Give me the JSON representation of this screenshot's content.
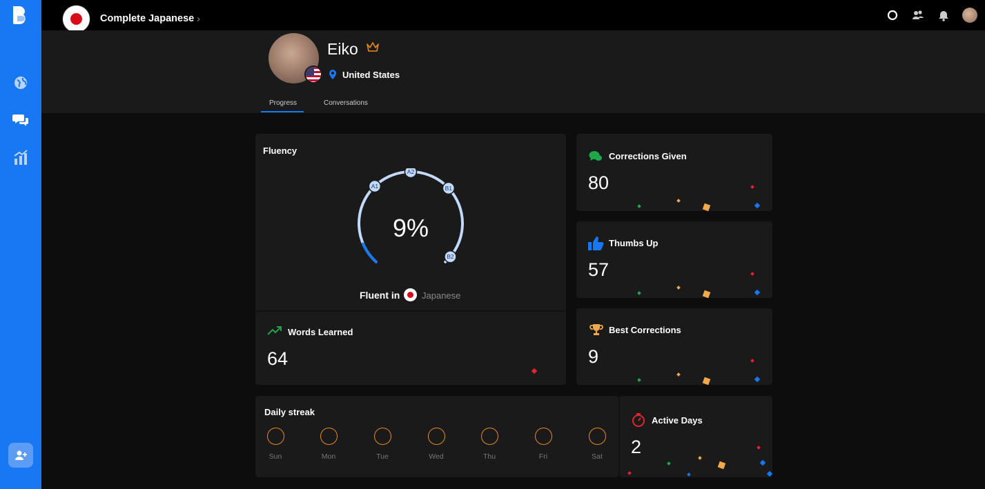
{
  "sidebar": {
    "nav": [
      {
        "icon": "globe-icon"
      },
      {
        "icon": "chat-icon"
      },
      {
        "icon": "stats-icon"
      }
    ],
    "add_friend_icon": "add-user-icon"
  },
  "topbar": {
    "course_title": "Complete Japanese",
    "chevron": "›",
    "icons": [
      "circle-icon",
      "users-icon",
      "bell-icon",
      "avatar"
    ]
  },
  "profile": {
    "name": "Eiko",
    "location": "United States",
    "tabs": [
      {
        "label": "Progress",
        "active": true
      },
      {
        "label": "Conversations",
        "active": false
      }
    ]
  },
  "fluency": {
    "title": "Fluency",
    "percent": "9%",
    "progress_fraction": 0.09,
    "levels": [
      "A1",
      "A2",
      "B1",
      "B2"
    ],
    "fluent_in_label": "Fluent in",
    "language": "Japanese"
  },
  "words_learned": {
    "title": "Words Learned",
    "value": "64"
  },
  "corrections_given": {
    "title": "Corrections Given",
    "value": "80"
  },
  "thumbs_up": {
    "title": "Thumbs Up",
    "value": "57"
  },
  "best_corrections": {
    "title": "Best Corrections",
    "value": "9"
  },
  "daily_streak": {
    "title": "Daily streak",
    "days": [
      "Sun",
      "Mon",
      "Tue",
      "Wed",
      "Thu",
      "Fri",
      "Sat"
    ]
  },
  "active_days": {
    "title": "Active Days",
    "value": "2"
  },
  "colors": {
    "brand_blue": "#1877f2",
    "streak_orange": "#e88a1a",
    "japan_red": "#d70c18"
  }
}
